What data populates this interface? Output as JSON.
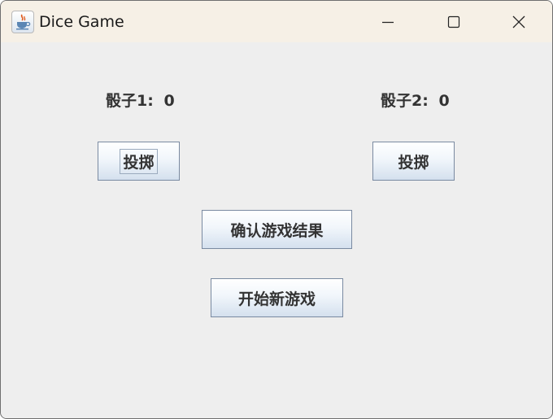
{
  "window": {
    "title": "Dice Game",
    "app_icon": "java-cup-icon",
    "controls": {
      "minimize": "minimize-icon",
      "maximize": "maximize-icon",
      "close": "close-icon"
    }
  },
  "dice": [
    {
      "label": "骰子1:",
      "value": "0",
      "roll_button": "投掷"
    },
    {
      "label": "骰子2:",
      "value": "0",
      "roll_button": "投掷"
    }
  ],
  "actions": {
    "confirm_result": "确认游戏结果",
    "new_game": "开始新游戏"
  },
  "colors": {
    "titlebar": "#f6f0e6",
    "content_bg": "#eeeeee",
    "text": "#333333",
    "button_border": "#7a8aa1"
  }
}
